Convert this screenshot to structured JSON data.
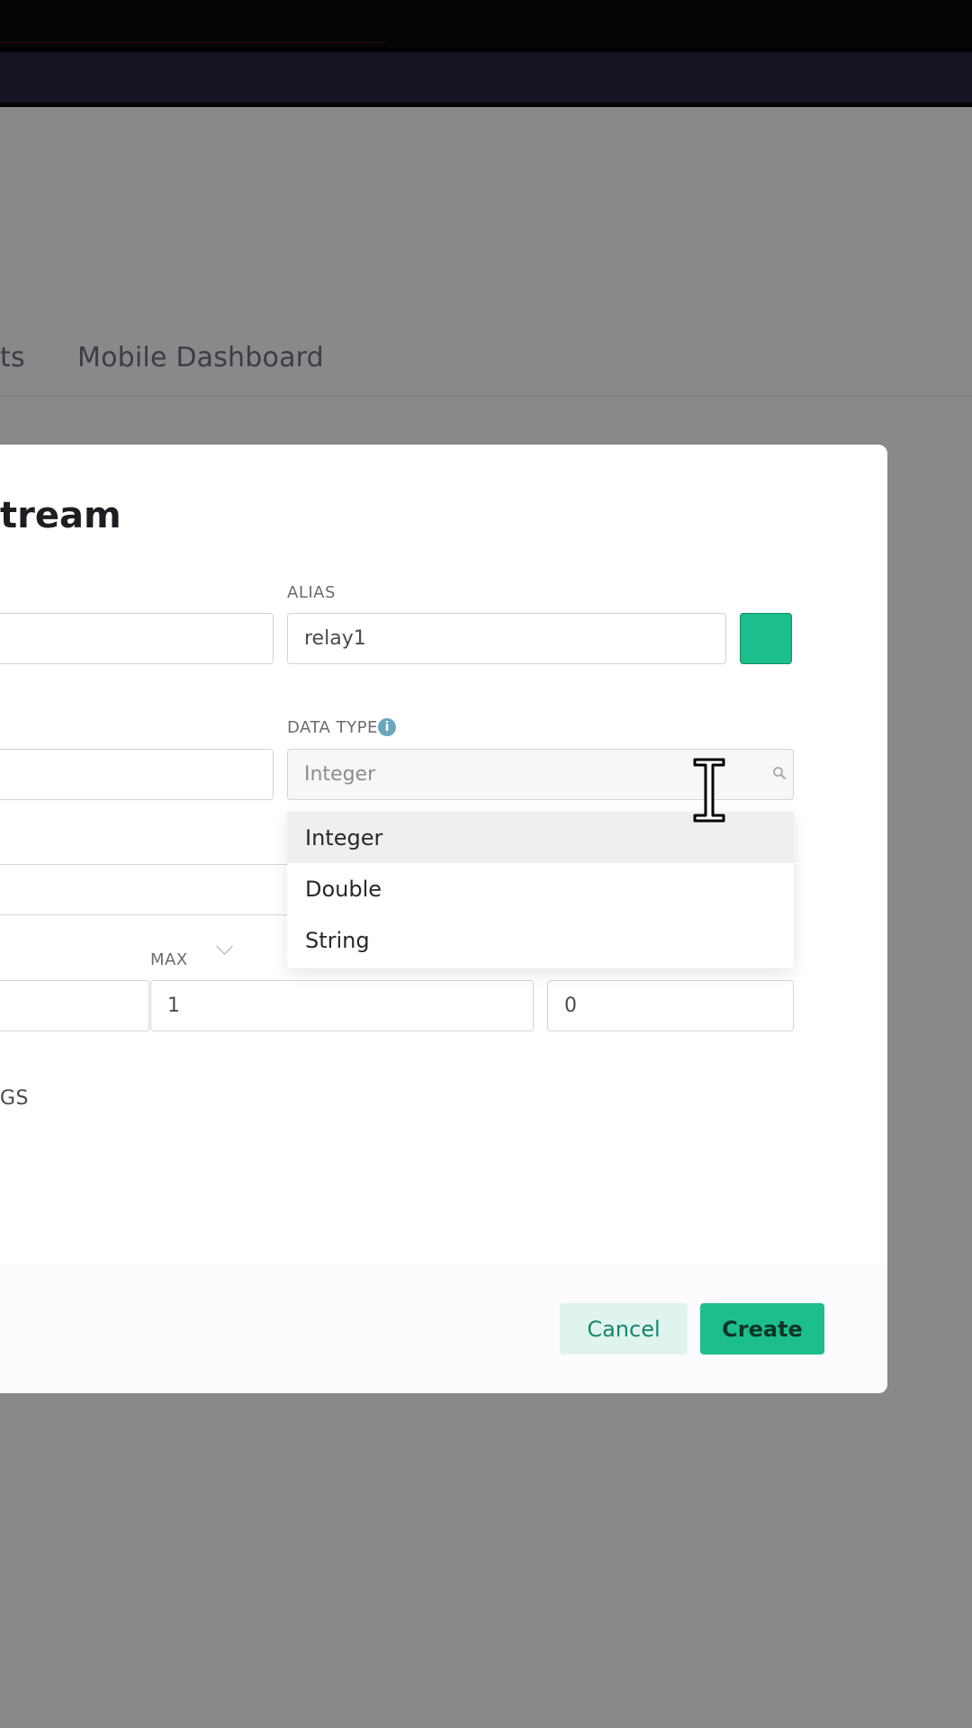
{
  "tabs": {
    "partial_label": "ts",
    "mobile_dashboard_label": "Mobile Dashboard"
  },
  "dialog": {
    "title_partial": "tream",
    "alias": {
      "label": "ALIAS",
      "value": "relay1"
    },
    "color_swatch": "#1cbe8c",
    "data_type": {
      "label": "DATA TYPE",
      "info_icon": "i",
      "placeholder": "Integer",
      "options": [
        "Integer",
        "Double",
        "String"
      ],
      "highlighted": "Integer"
    },
    "max": {
      "label": "MAX",
      "value": "1"
    },
    "default_value": "0",
    "settings_partial": "GS",
    "buttons": {
      "cancel": "Cancel",
      "create": "Create"
    }
  },
  "colors": {
    "accent": "#1cbe8c",
    "overlay": "#8a888b"
  },
  "icons": {
    "chevron": "chevron-down-icon",
    "search": "search-icon",
    "info": "info-icon",
    "cursor": "text-cursor-icon"
  }
}
